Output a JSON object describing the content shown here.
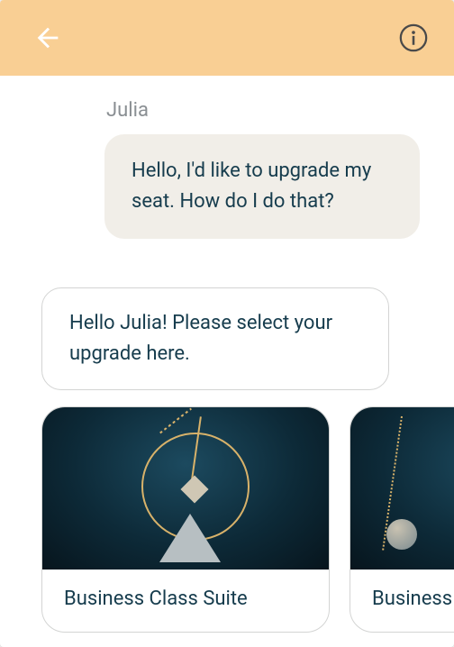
{
  "header": {
    "back_icon": "back-arrow-icon",
    "info_icon": "info-icon"
  },
  "chat": {
    "sender_name": "Julia",
    "user_message": "Hello, I'd like to upgrade my seat. How do I do that?",
    "bot_message": "Hello Julia! Please select your upgrade here."
  },
  "cards": [
    {
      "label": "Business Class Suite"
    },
    {
      "label": "Business"
    }
  ]
}
